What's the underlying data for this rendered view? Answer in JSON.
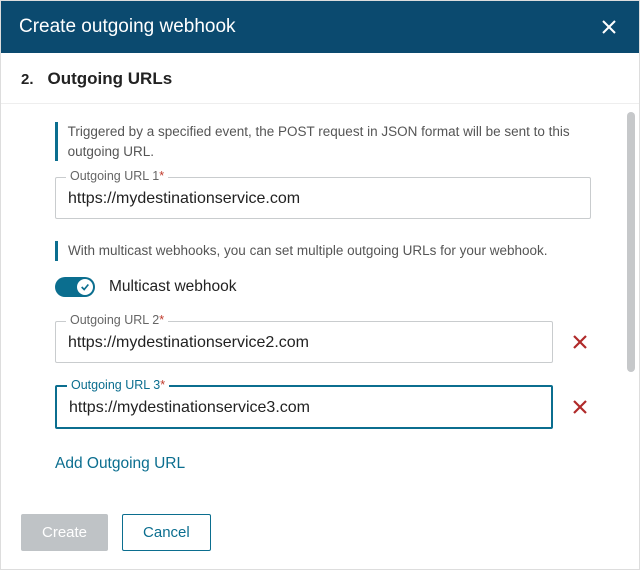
{
  "header": {
    "title": "Create outgoing webhook"
  },
  "step": {
    "number": "2.",
    "title": "Outgoing URLs"
  },
  "hints": {
    "trigger": "Triggered by a specified event, the POST request in JSON format will be sent to this outgoing URL.",
    "multicast": "With multicast webhooks, you can set multiple outgoing URLs for your webhook."
  },
  "fields": {
    "url1": {
      "label": "Outgoing URL 1",
      "value": "https://mydestinationservice.com",
      "required": true
    },
    "url2": {
      "label": "Outgoing URL 2",
      "value": "https://mydestinationservice2.com",
      "required": true
    },
    "url3": {
      "label": "Outgoing URL 3",
      "value": "https://mydestinationservice3.com",
      "required": true
    }
  },
  "toggle": {
    "multicast_label": "Multicast webhook",
    "on": true
  },
  "actions": {
    "add_url": "Add Outgoing URL",
    "create": "Create",
    "cancel": "Cancel"
  }
}
